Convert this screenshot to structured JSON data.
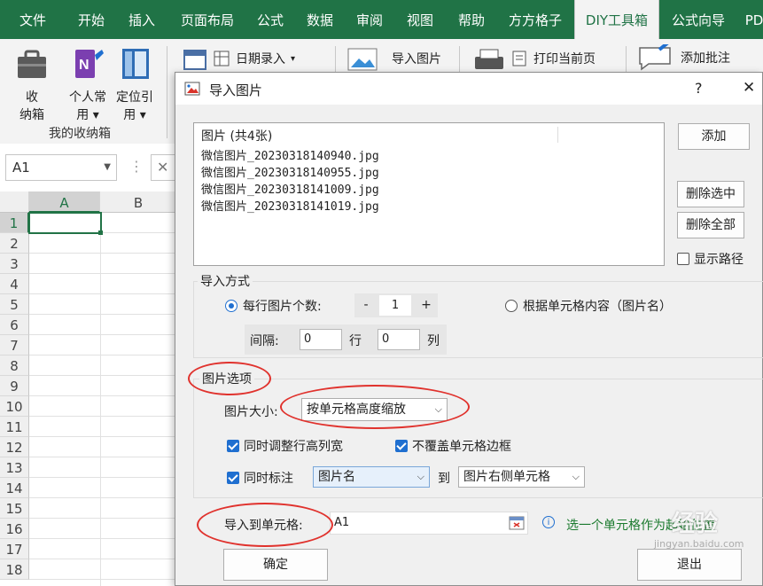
{
  "ribbon_tabs": [
    "文件",
    "开始",
    "插入",
    "页面布局",
    "公式",
    "数据",
    "审阅",
    "视图",
    "帮助",
    "方方格子",
    "DIY工具箱",
    "公式向导",
    "PD"
  ],
  "ribbon": {
    "btn_shoucang_1": "收",
    "btn_shoucang_2": "纳箱",
    "btn_personal_1": "个人常",
    "btn_personal_2": "用",
    "btn_locate_1": "定位引",
    "btn_locate_2": "用",
    "group_label": "我的收纳箱",
    "date_entry": "日期录入",
    "import_image": "导入图片",
    "print_page": "打印当前页",
    "add_comment": "添加批注"
  },
  "formula_bar": {
    "name_box": "A1"
  },
  "sheet": {
    "columns": [
      "A",
      "B"
    ],
    "rows": [
      "1",
      "2",
      "3",
      "4",
      "5",
      "6",
      "7",
      "8",
      "9",
      "10",
      "11",
      "12",
      "13",
      "14",
      "15",
      "16",
      "17",
      "18"
    ]
  },
  "dialog": {
    "title": "导入图片",
    "help": "?",
    "close": "✕",
    "list_header": "图片 (共4张)",
    "files": [
      "微信图片_20230318140940.jpg",
      "微信图片_20230318140955.jpg",
      "微信图片_20230318141009.jpg",
      "微信图片_20230318141019.jpg"
    ],
    "add_btn": "添加",
    "delete_selected_btn": "删除选中",
    "delete_all_btn": "删除全部",
    "show_path_label": "显示路径",
    "import_mode_label": "导入方式",
    "per_row_label": "每行图片个数:",
    "minus": "-",
    "per_row_value": "1",
    "plus": "+",
    "by_cell_label": "根据单元格内容（图片名）",
    "spacing_label": "间隔:",
    "spacing_row_value": "0",
    "row_label": "行",
    "spacing_col_value": "0",
    "col_label": "列",
    "image_options_label": "图片选项",
    "image_size_label": "图片大小:",
    "image_size_value": "按单元格高度缩放",
    "adjust_rowcol_label": "同时调整行高列宽",
    "no_cover_border_label": "不覆盖单元格边框",
    "annotate_label": "同时标注",
    "annotate_value": "图片名",
    "to_label": "到",
    "target_value": "图片右侧单元格",
    "import_to_label": "导入到单元格:",
    "import_to_value": "A1",
    "hint_text": "选一个单元格作为起始位置",
    "ok_btn": "确定",
    "exit_btn": "退出"
  },
  "watermark": {
    "line1": "经验",
    "line2": "jingyan.baidu.com"
  },
  "colors": {
    "excel_green": "#207346",
    "accent_blue": "#1f6fd0",
    "annotation_red": "#e0322d",
    "hint_green": "#1b7a2e"
  }
}
